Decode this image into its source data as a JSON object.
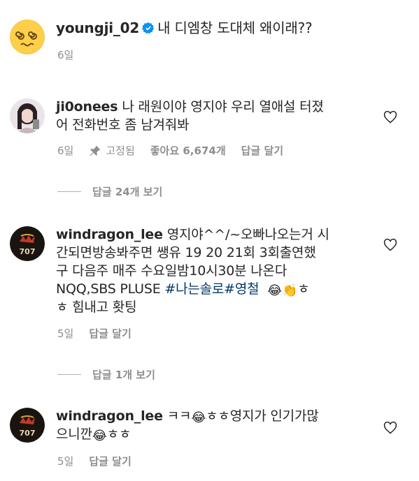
{
  "post": {
    "username": "youngji_02",
    "caption": "내 디엠창 도대체 왜이래??",
    "time": "6일"
  },
  "comments": [
    {
      "username": "ji0onees",
      "text_line1": "나 래원이야 영지야 우리 열애설 터졌",
      "text_line2": "어 전화번호 좀 남겨줘봐",
      "time": "6일",
      "pinned": "고정됨",
      "likes": "좋아요 6,674개",
      "reply": "답글 달기",
      "view_replies": "답글 24개 보기"
    },
    {
      "username": "windragon_lee",
      "text_line1": "영지야^^/~오빠나오는거 시",
      "text_line2": "간되면방송봐주면 쌩유 19  20  21회 3회출연했",
      "text_line3": "구 다음주 매주 수요일밤10시30분 나온다",
      "text_line4_plain": "NQQ,SBS PLUSE ",
      "hashtags": "#나는솔로#영철",
      "text_line4_tail": "ㅎ",
      "text_line5": "ㅎ 힘내고 홧팅",
      "time": "5일",
      "reply": "답글 달기",
      "view_replies": "답글 1개 보기"
    },
    {
      "username": "windragon_lee",
      "text_line1_a": "ㅋㅋ",
      "text_line1_b": "ㅎㅎ영지가 인기가많",
      "text_line2_a": "으니깐",
      "text_line2_b": "ㅎㅎ",
      "time": "5일",
      "reply": "답글 달기"
    }
  ],
  "emojis": {
    "laugh_cry": "😂",
    "clap": "👏"
  },
  "colors": {
    "text": "#262626",
    "meta": "#8e8e8e",
    "hashtag": "#00376b",
    "verified": "#0095f6"
  }
}
